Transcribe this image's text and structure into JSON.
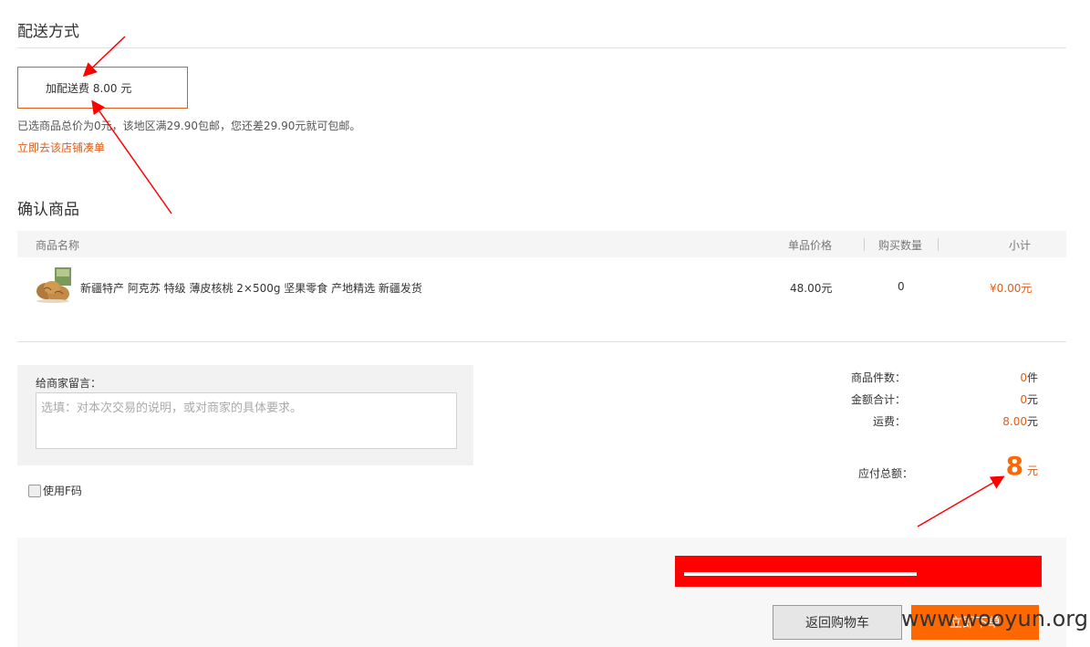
{
  "shipping": {
    "title": "配送方式",
    "option_label": "加配送费 8.00 元",
    "note": "已选商品总价为0元，该地区满29.90包邮，您还差29.90元就可包邮。",
    "shop_link": "立即去该店铺凑单"
  },
  "confirm": {
    "title": "确认商品",
    "columns": [
      "商品名称",
      "单品价格",
      "购买数量",
      "小计"
    ],
    "items": [
      {
        "name": "新疆特产 阿克苏 特级 薄皮核桃 2×500g 坚果零食 产地精选 新疆发货",
        "price": "48.00元",
        "quantity": "0",
        "subtotal": "¥0.00元"
      }
    ]
  },
  "message": {
    "label": "给商家留言：",
    "placeholder": "选填：对本次交易的说明，或对商家的具体要求。"
  },
  "fcode": {
    "label": "使用F码"
  },
  "summary": {
    "count_label": "商品件数：",
    "count_value": "0",
    "count_unit": "件",
    "amount_label": "金额合计：",
    "amount_value": "0",
    "amount_unit": "元",
    "shipping_label": "运费：",
    "shipping_value": "8.00",
    "shipping_unit": "元",
    "total_label": "应付总额：",
    "total_value": "8",
    "total_unit": "元"
  },
  "actions": {
    "back_label": "返回购物车",
    "submit_label": "立即下单"
  },
  "watermark": "www.wooyun.org",
  "colors": {
    "accent": "#ff6700",
    "link": "#e05c16",
    "annotation": "#ff0000"
  }
}
